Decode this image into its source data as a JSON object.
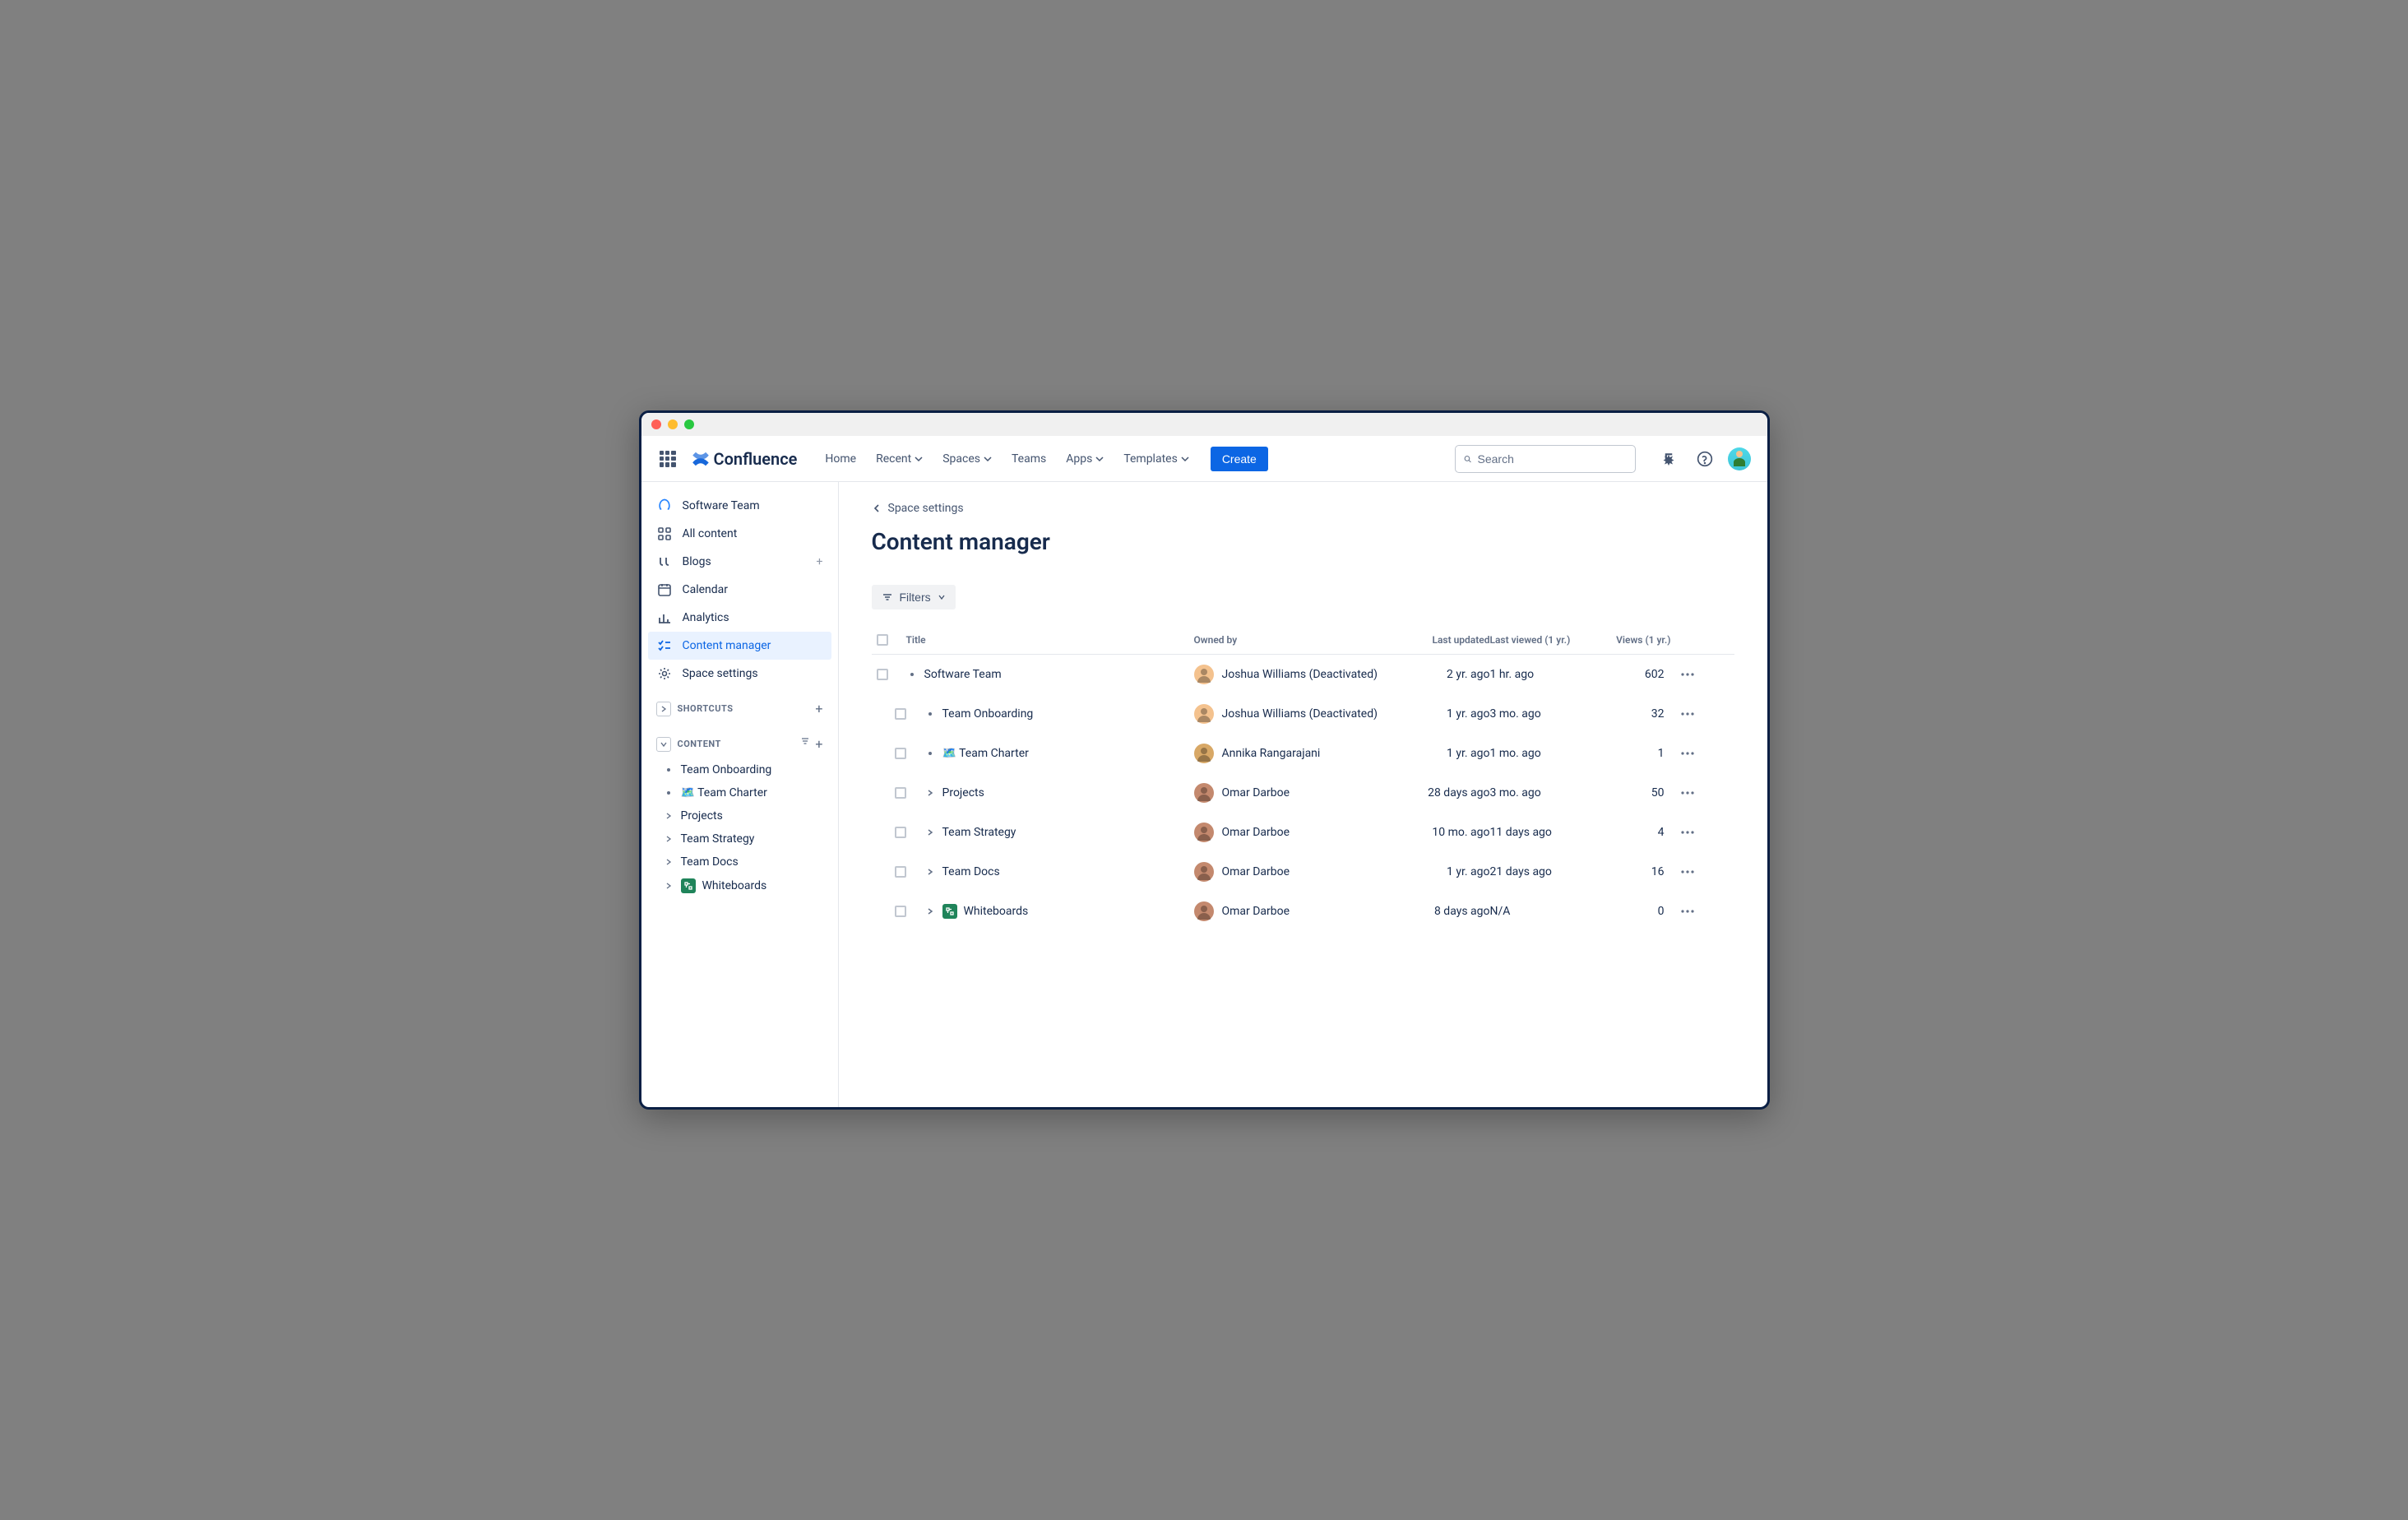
{
  "product": "Confluence",
  "nav": {
    "home": "Home",
    "recent": "Recent",
    "spaces": "Spaces",
    "teams": "Teams",
    "apps": "Apps",
    "templates": "Templates",
    "create": "Create"
  },
  "search": {
    "placeholder": "Search"
  },
  "sidebar": {
    "space_name": "Software Team",
    "items": {
      "all_content": "All content",
      "blogs": "Blogs",
      "calendar": "Calendar",
      "analytics": "Analytics",
      "content_manager": "Content manager",
      "space_settings": "Space settings"
    },
    "shortcuts_label": "SHORTCUTS",
    "content_label": "CONTENT",
    "tree": [
      {
        "label": "Team Onboarding",
        "marker": "bullet"
      },
      {
        "label": "🗺️ Team Charter",
        "marker": "bullet"
      },
      {
        "label": "Projects",
        "marker": "chev"
      },
      {
        "label": "Team Strategy",
        "marker": "chev"
      },
      {
        "label": "Team Docs",
        "marker": "chev"
      },
      {
        "label": "Whiteboards",
        "marker": "chev",
        "icon": "wb"
      }
    ]
  },
  "breadcrumb": "Space settings",
  "page_title": "Content manager",
  "filters_label": "Filters",
  "columns": {
    "title": "Title",
    "owned_by": "Owned by",
    "last_updated": "Last updated",
    "last_viewed": "Last viewed (1 yr.)",
    "views": "Views (1 yr.)"
  },
  "rows": [
    {
      "indent": 0,
      "marker": "bullet",
      "title": "Software Team",
      "owner": "Joshua Williams (Deactivated)",
      "avatar_bg": "#f4c28e",
      "updated": "2 yr. ago",
      "viewed": "1 hr. ago",
      "views": "602"
    },
    {
      "indent": 1,
      "marker": "bullet",
      "title": "Team Onboarding",
      "owner": "Joshua Williams (Deactivated)",
      "avatar_bg": "#f4c28e",
      "updated": "1 yr. ago",
      "viewed": "3 mo. ago",
      "views": "32"
    },
    {
      "indent": 1,
      "marker": "bullet",
      "title": "🗺️ Team Charter",
      "owner": "Annika Rangarajani",
      "avatar_bg": "#d8a866",
      "updated": "1 yr. ago",
      "viewed": "1 mo. ago",
      "views": "1"
    },
    {
      "indent": 1,
      "marker": "chev",
      "title": "Projects",
      "owner": "Omar Darboe",
      "avatar_bg": "#c4896e",
      "updated": "28 days ago",
      "viewed": "3 mo. ago",
      "views": "50"
    },
    {
      "indent": 1,
      "marker": "chev",
      "title": "Team Strategy",
      "owner": "Omar Darboe",
      "avatar_bg": "#c4896e",
      "updated": "10 mo. ago",
      "viewed": "11 days ago",
      "views": "4"
    },
    {
      "indent": 1,
      "marker": "chev",
      "title": "Team Docs",
      "owner": "Omar Darboe",
      "avatar_bg": "#c4896e",
      "updated": "1 yr. ago",
      "viewed": "21 days ago",
      "views": "16"
    },
    {
      "indent": 1,
      "marker": "chev",
      "title": "Whiteboards",
      "icon": "wb",
      "owner": "Omar Darboe",
      "avatar_bg": "#c4896e",
      "updated": "8 days ago",
      "viewed": "N/A",
      "views": "0"
    }
  ]
}
